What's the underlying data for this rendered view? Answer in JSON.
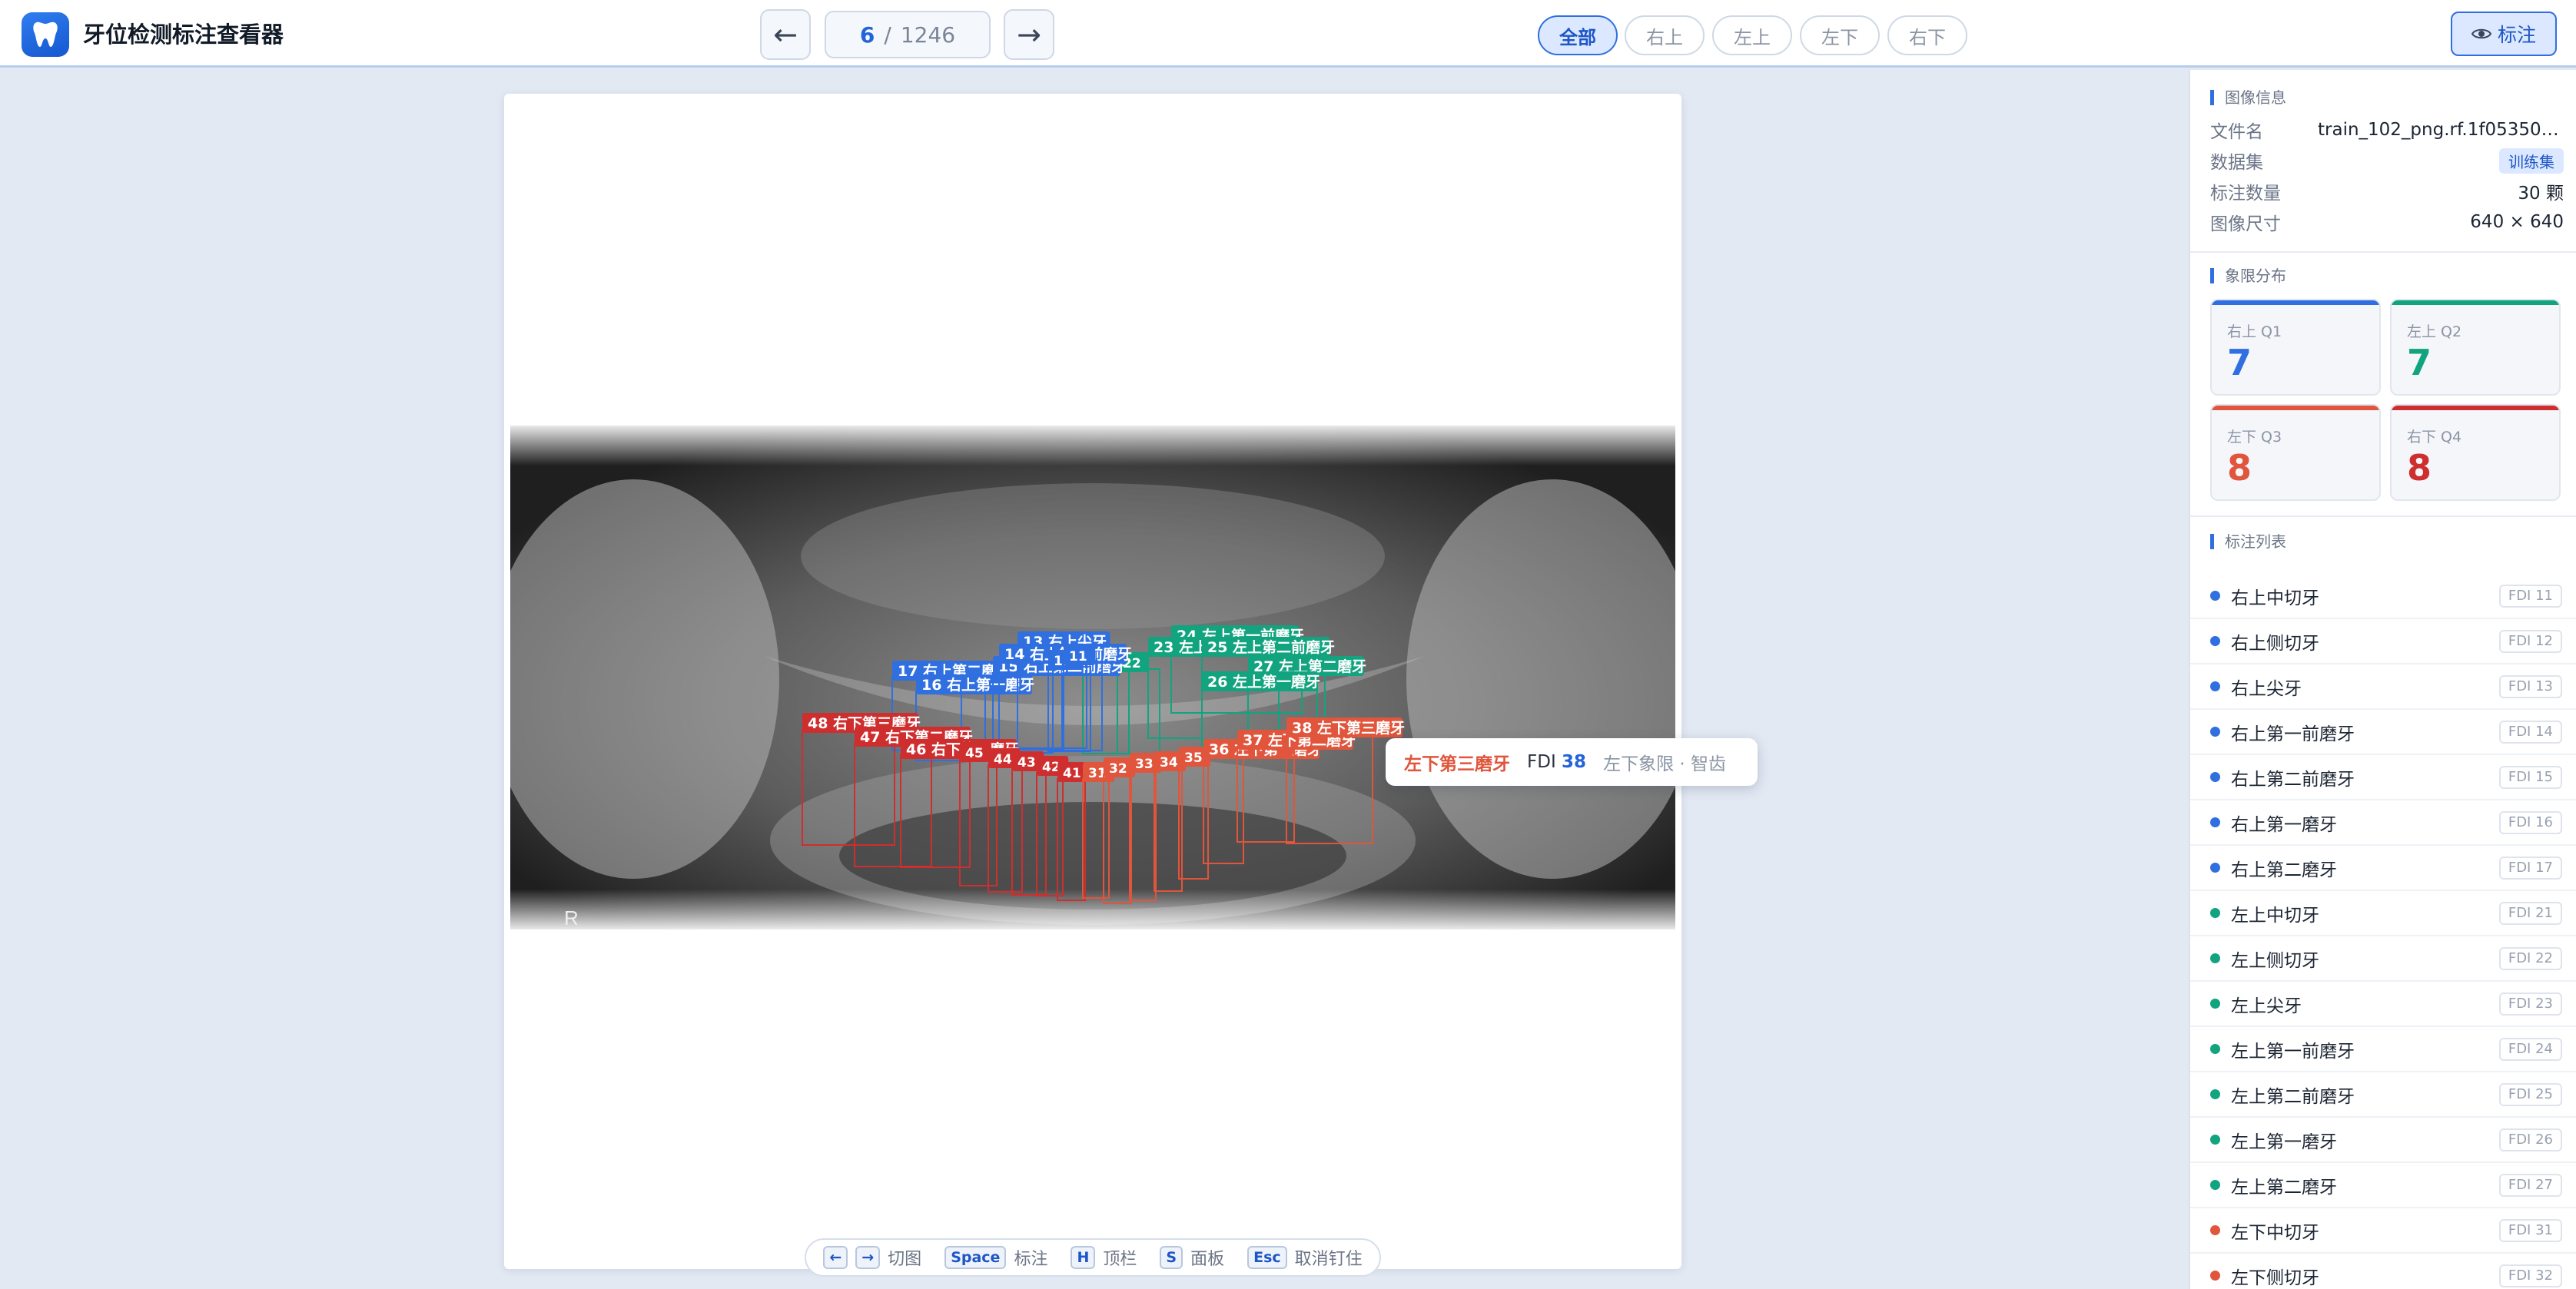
{
  "app": {
    "title": "牙位检测标注查看器",
    "logo_icon": "tooth-icon",
    "accent": "#2f6fe0"
  },
  "nav": {
    "prev": "←",
    "next": "→",
    "current": "6",
    "separator": "/",
    "total": "1246"
  },
  "filters": [
    {
      "label": "全部",
      "active": true
    },
    {
      "label": "右上",
      "active": false
    },
    {
      "label": "左上",
      "active": false
    },
    {
      "label": "左下",
      "active": false
    },
    {
      "label": "右下",
      "active": false
    }
  ],
  "annotation_toggle": {
    "icon": "eye-icon",
    "label": "标注"
  },
  "xray": {
    "corner_mark": "R"
  },
  "boxes": [
    {
      "fdi": 24,
      "label": "24 左上第一前磨牙",
      "q": 2
    },
    {
      "fdi": 23,
      "label": "23 左上尖牙",
      "q": 2
    },
    {
      "fdi": 25,
      "label": "25 左上第二前磨牙",
      "q": 2
    },
    {
      "fdi": 27,
      "label": "27 左上第二磨牙",
      "q": 2
    },
    {
      "fdi": 26,
      "label": "26 左上第一磨牙",
      "q": 2
    },
    {
      "fdi": 21,
      "label": "21",
      "q": 2
    },
    {
      "fdi": 22,
      "label": "22",
      "q": 2
    },
    {
      "fdi": 17,
      "label": "17 右上第二磨牙",
      "q": 1
    },
    {
      "fdi": 16,
      "label": "16 右上第一磨牙",
      "q": 1
    },
    {
      "fdi": 15,
      "label": "15 右上第二前磨牙",
      "q": 1
    },
    {
      "fdi": 13,
      "label": "13 右上尖牙",
      "q": 1
    },
    {
      "fdi": 14,
      "label": "14 右上第一前磨牙",
      "q": 1
    },
    {
      "fdi": 12,
      "label": "12",
      "q": 1
    },
    {
      "fdi": 11,
      "label": "11",
      "q": 1
    },
    {
      "fdi": 48,
      "label": "48 右下第三磨牙",
      "q": 4
    },
    {
      "fdi": 47,
      "label": "47 右下第二磨牙",
      "q": 4
    },
    {
      "fdi": 46,
      "label": "46 右下第一磨牙",
      "q": 4
    },
    {
      "fdi": 45,
      "label": "45",
      "q": 4
    },
    {
      "fdi": 44,
      "label": "44",
      "q": 4
    },
    {
      "fdi": 43,
      "label": "43",
      "q": 4
    },
    {
      "fdi": 42,
      "label": "42",
      "q": 4
    },
    {
      "fdi": 41,
      "label": "41",
      "q": 4
    },
    {
      "fdi": 31,
      "label": "31",
      "q": 3
    },
    {
      "fdi": 32,
      "label": "32",
      "q": 3
    },
    {
      "fdi": 33,
      "label": "33",
      "q": 3
    },
    {
      "fdi": 34,
      "label": "34",
      "q": 3
    },
    {
      "fdi": 35,
      "label": "35",
      "q": 3
    },
    {
      "fdi": 36,
      "label": "36 左下第一磨牙",
      "q": 3
    },
    {
      "fdi": 37,
      "label": "37 左下第二磨牙",
      "q": 3
    },
    {
      "fdi": 38,
      "label": "38 左下第三磨牙",
      "q": 3
    }
  ],
  "quadrant_colors": {
    "1": "#2f6fe0",
    "2": "#12a37f",
    "3": "#e0553c",
    "4": "#cf2e2e"
  },
  "tooltip": {
    "name": "左下第三磨牙",
    "fdi_prefix": "FDI",
    "fdi": "38",
    "desc": "左下象限 · 智齿"
  },
  "shortcuts": [
    {
      "keys": [
        "←",
        "→"
      ],
      "label": "切图"
    },
    {
      "keys": [
        "Space"
      ],
      "label": "标注"
    },
    {
      "keys": [
        "H"
      ],
      "label": "顶栏"
    },
    {
      "keys": [
        "S"
      ],
      "label": "面板"
    },
    {
      "keys": [
        "Esc"
      ],
      "label": "取消钉住"
    }
  ],
  "panel": {
    "image_info": {
      "title": "图像信息",
      "rows": [
        {
          "key": "文件名",
          "value": "train_102_png.rf.1f053508c..."
        },
        {
          "key": "数据集",
          "value": "训练集",
          "tag": true
        },
        {
          "key": "标注数量",
          "value": "30 颗"
        },
        {
          "key": "图像尺寸",
          "value": "640 × 640"
        }
      ]
    },
    "quadrants": {
      "title": "象限分布",
      "cards": [
        {
          "label": "右上 Q1",
          "count": "7",
          "color": "#2f6fe0"
        },
        {
          "label": "左上 Q2",
          "count": "7",
          "color": "#12a37f"
        },
        {
          "label": "左下 Q3",
          "count": "8",
          "color": "#e0553c"
        },
        {
          "label": "右下 Q4",
          "count": "8",
          "color": "#cf2e2e"
        }
      ]
    },
    "list": {
      "title": "标注列表",
      "items": [
        {
          "name": "右上中切牙",
          "fdi": "FDI 11",
          "color": "#2f6fe0"
        },
        {
          "name": "右上侧切牙",
          "fdi": "FDI 12",
          "color": "#2f6fe0"
        },
        {
          "name": "右上尖牙",
          "fdi": "FDI 13",
          "color": "#2f6fe0"
        },
        {
          "name": "右上第一前磨牙",
          "fdi": "FDI 14",
          "color": "#2f6fe0"
        },
        {
          "name": "右上第二前磨牙",
          "fdi": "FDI 15",
          "color": "#2f6fe0"
        },
        {
          "name": "右上第一磨牙",
          "fdi": "FDI 16",
          "color": "#2f6fe0"
        },
        {
          "name": "右上第二磨牙",
          "fdi": "FDI 17",
          "color": "#2f6fe0"
        },
        {
          "name": "左上中切牙",
          "fdi": "FDI 21",
          "color": "#12a37f"
        },
        {
          "name": "左上侧切牙",
          "fdi": "FDI 22",
          "color": "#12a37f"
        },
        {
          "name": "左上尖牙",
          "fdi": "FDI 23",
          "color": "#12a37f"
        },
        {
          "name": "左上第一前磨牙",
          "fdi": "FDI 24",
          "color": "#12a37f"
        },
        {
          "name": "左上第二前磨牙",
          "fdi": "FDI 25",
          "color": "#12a37f"
        },
        {
          "name": "左上第一磨牙",
          "fdi": "FDI 26",
          "color": "#12a37f"
        },
        {
          "name": "左上第二磨牙",
          "fdi": "FDI 27",
          "color": "#12a37f"
        },
        {
          "name": "左下中切牙",
          "fdi": "FDI 31",
          "color": "#e0553c"
        },
        {
          "name": "左下侧切牙",
          "fdi": "FDI 32",
          "color": "#e0553c"
        }
      ]
    }
  }
}
